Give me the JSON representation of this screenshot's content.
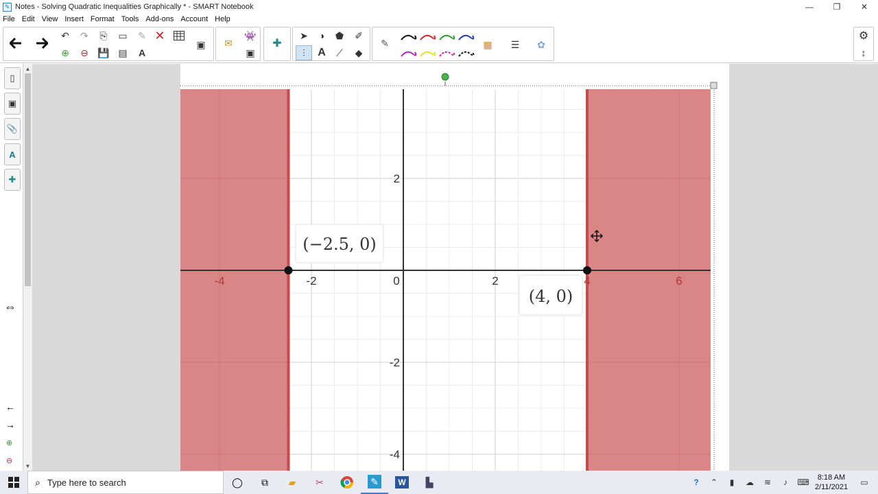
{
  "window": {
    "title": "Notes - Solving Quadratic Inequalities Graphically * - SMART Notebook",
    "controls": [
      "—",
      "❐",
      "✕"
    ]
  },
  "menu": [
    "File",
    "Edit",
    "View",
    "Insert",
    "Format",
    "Tools",
    "Add-ons",
    "Account",
    "Help"
  ],
  "toolbar": {
    "icons": [
      "back-arrow-icon",
      "forward-arrow-icon",
      "undo-icon",
      "redo-icon",
      "delete-icon",
      "table-icon",
      "select-icon",
      "text-icon",
      "eraser-icon",
      "pen-icon",
      "settings-icon"
    ]
  },
  "sidetabs": [
    "page-sorter-icon",
    "gallery-icon",
    "attachments-icon",
    "properties-icon",
    "addons-icon"
  ],
  "graph": {
    "x_ticks": [
      "-4",
      "-2",
      "0",
      "2",
      "4",
      "6"
    ],
    "y_ticks": [
      "2",
      "-2",
      "-4"
    ],
    "point_labels": [
      "(−2.5, 0)",
      "(4, 0)"
    ],
    "points_x": [
      -2.5,
      4
    ],
    "shade_color": "#d98080",
    "boundary_color": "#c84a4a"
  },
  "taskbar": {
    "search_placeholder": "Type here to search",
    "time": "8:18 AM",
    "date": "2/11/2021"
  }
}
